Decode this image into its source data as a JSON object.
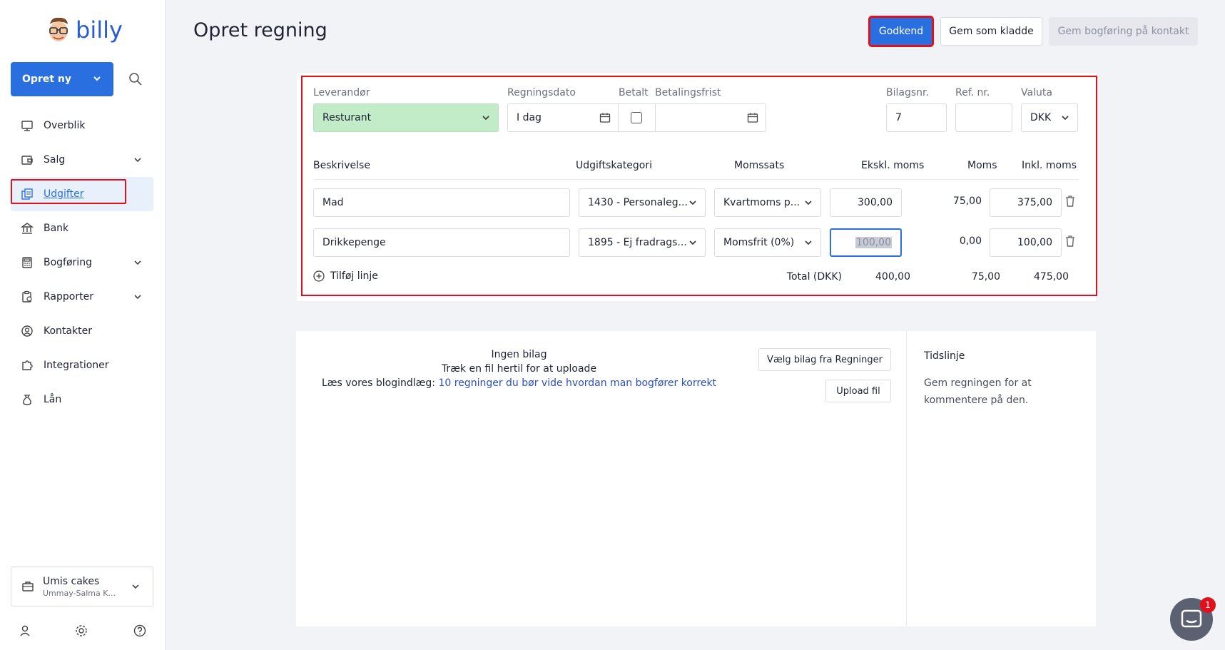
{
  "app": {
    "logo_text": "billy"
  },
  "sidebar": {
    "create_button": "Opret ny",
    "items": [
      {
        "label": "Overblik",
        "icon": "dashboard-icon",
        "has_chevron": false
      },
      {
        "label": "Salg",
        "icon": "wallet-icon",
        "has_chevron": true
      },
      {
        "label": "Udgifter",
        "icon": "bills-icon",
        "has_chevron": false,
        "active": true
      },
      {
        "label": "Bank",
        "icon": "bank-icon",
        "has_chevron": false
      },
      {
        "label": "Bogføring",
        "icon": "calculator-icon",
        "has_chevron": true
      },
      {
        "label": "Rapporter",
        "icon": "report-icon",
        "has_chevron": true
      },
      {
        "label": "Kontakter",
        "icon": "contact-icon",
        "has_chevron": false
      },
      {
        "label": "Integrationer",
        "icon": "puzzle-icon",
        "has_chevron": false
      },
      {
        "label": "Lån",
        "icon": "moneybag-icon",
        "has_chevron": false
      }
    ],
    "org": {
      "name": "Umis cakes",
      "user": "Ummay-Salma K..."
    }
  },
  "header": {
    "title": "Opret regning",
    "approve": "Godkend",
    "save_draft": "Gem som kladde",
    "save_contact": "Gem bogføring på kontakt"
  },
  "form": {
    "supplier_label": "Leverandør",
    "supplier_value": "Resturant",
    "date_label": "Regningsdato",
    "date_value": "I dag",
    "paid_label": "Betalt",
    "due_label": "Betalingsfrist",
    "due_value": "",
    "voucher_label": "Bilagsnr.",
    "voucher_value": "7",
    "ref_label": "Ref. nr.",
    "ref_value": "",
    "currency_label": "Valuta",
    "currency_value": "DKK"
  },
  "lines": {
    "headers": {
      "description": "Beskrivelse",
      "category": "Udgiftskategori",
      "vat_rate": "Momssats",
      "excl": "Ekskl. moms",
      "vat": "Moms",
      "incl": "Inkl. moms"
    },
    "rows": [
      {
        "description": "Mad",
        "category": "1430 - Personaleg...",
        "vat_rate": "Kvartmoms p...",
        "excl": "300,00",
        "vat": "75,00",
        "incl": "375,00"
      },
      {
        "description": "Drikkepenge",
        "category": "1895 - Ej fradrags...",
        "vat_rate": "Momsfrit (0%)",
        "excl": "100,00",
        "vat": "0,00",
        "incl": "100,00"
      }
    ],
    "add_line": "Tilføj linje",
    "total_label": "Total (DKK)",
    "total_excl": "400,00",
    "total_vat": "75,00",
    "total_incl": "475,00"
  },
  "attachments": {
    "none": "Ingen bilag",
    "drag": "Træk en fil hertil for at uploade",
    "blog_prefix": "Læs vores blogindlæg:",
    "blog_link": "10 regninger du bør vide hvordan man bogfører korrekt",
    "choose_button": "Vælg bilag fra Regninger",
    "upload_button": "Upload fil"
  },
  "timeline": {
    "title": "Tidslinje",
    "text": "Gem regningen for at kommentere på den."
  },
  "chat": {
    "badge": "1"
  }
}
